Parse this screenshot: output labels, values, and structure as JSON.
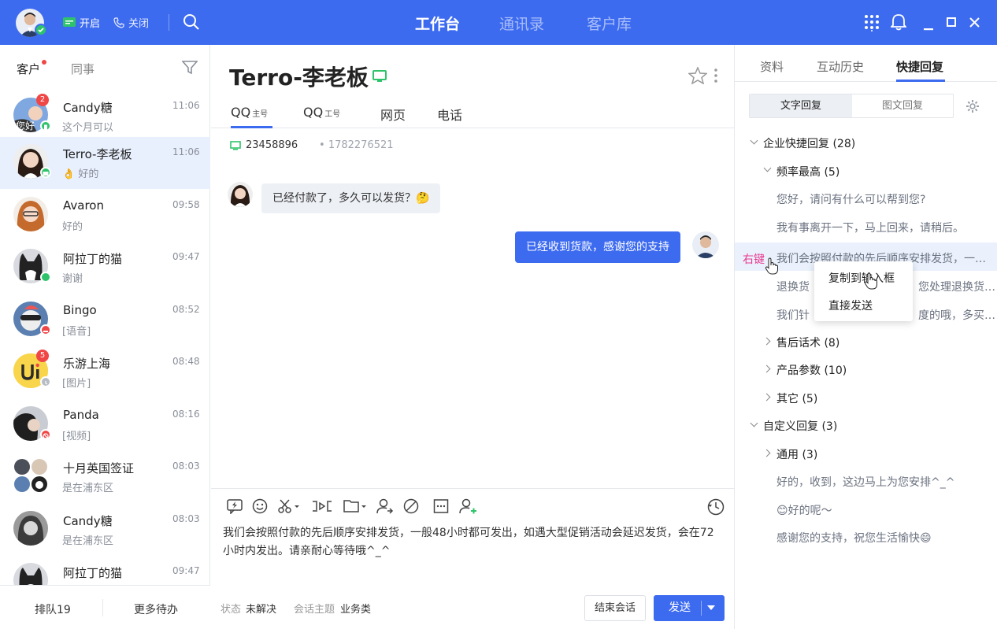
{
  "topbar": {
    "open_label": "开启",
    "close_label": "关闭",
    "tabs": [
      "工作台",
      "通讯录",
      "客户库"
    ],
    "active_tab": 0
  },
  "left": {
    "tabs": [
      "客户",
      "同事"
    ],
    "contacts": [
      {
        "name": "Candy糖",
        "msg": "这个月可以",
        "time": "11:06",
        "badge": "2",
        "avatar_text": "您好"
      },
      {
        "name": "Terro-李老板",
        "msg": "👌 好的",
        "time": "11:06"
      },
      {
        "name": "Avaron",
        "msg": "好的",
        "time": "09:58"
      },
      {
        "name": "阿拉丁的猫",
        "msg": "谢谢",
        "time": "09:47"
      },
      {
        "name": "Bingo",
        "msg": "[语音]",
        "time": "08:52"
      },
      {
        "name": "乐游上海",
        "msg": "[图片]",
        "time": "08:48",
        "badge": "5",
        "avatar_text": "U"
      },
      {
        "name": "Panda",
        "msg": "[视频]",
        "time": "08:16"
      },
      {
        "name": "十月英国签证",
        "msg": "是在浦东区",
        "time": "08:03"
      },
      {
        "name": "Candy糖",
        "msg": "是在浦东区",
        "time": "08:03"
      },
      {
        "name": "阿拉丁的猫",
        "msg": "",
        "time": "09:47"
      }
    ],
    "bottom": {
      "queue": "排队19",
      "more": "更多待办"
    }
  },
  "chat": {
    "title": "Terro-李老板",
    "tabs": [
      {
        "label": "QQ",
        "sub": "主号"
      },
      {
        "label": "QQ",
        "sub": "工号"
      },
      {
        "label": "网页",
        "sub": ""
      },
      {
        "label": "电话",
        "sub": ""
      }
    ],
    "qq_id": "23458896",
    "phone": "1782276521",
    "messages": {
      "incoming": "已经付款了，多久可以发货？🤔",
      "outgoing": "已经收到货款，感谢您的支持"
    },
    "compose_text": "我们会按照付款的先后顺序安排发货，一般48小时都可发出，如遇大型促销活动会延迟发货，会在72小时内发出。请亲耐心等待哦^_^",
    "footer": {
      "status_label": "状态",
      "status_value": "未解决",
      "topic_label": "会话主题",
      "topic_value": "业务类",
      "end_button": "结束会话",
      "send_button": "发送"
    }
  },
  "right": {
    "tabs": [
      "资料",
      "互动历史",
      "快捷回复"
    ],
    "segments": [
      "文字回复",
      "图文回复"
    ],
    "tree": {
      "group1": "企业快捷回复 (28)",
      "sub1": "频率最高 (5)",
      "leaves1": [
        "您好，请问有什么可以帮到您?",
        "我有事离开一下，马上回来，请稍后。",
        "我们会按照付款的先后顺序安排发货，一…",
        "退换货",
        "您处理退换货…",
        "我们针",
        "度的哦，多买…"
      ],
      "sub2": "售后话术 (8)",
      "sub3": "产品参数 (10)",
      "sub4": "其它 (5)",
      "group2": "自定义回复 (3)",
      "sub5": "通用 (3)",
      "leaves2": [
        "好的，收到，这边马上为您安排^_^",
        "😊好的呢～",
        "感谢您的支持，祝您生活愉快😄"
      ]
    },
    "right_click_label": "右键",
    "context_menu": [
      "复制到输入框",
      "直接发送"
    ]
  },
  "colors": {
    "primary": "#3d6bf0",
    "badge": "#f04646",
    "online": "#2ec36a",
    "highlight": "#e83a8e"
  }
}
